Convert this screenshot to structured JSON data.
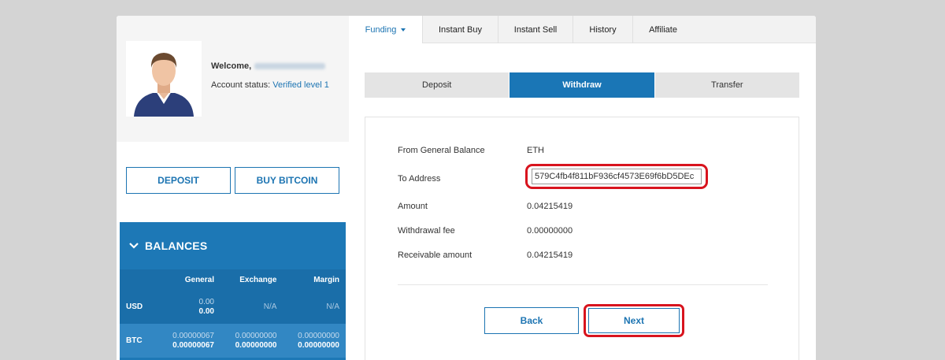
{
  "profile": {
    "welcome_label": "Welcome,",
    "account_status_label": "Account status:",
    "account_status_value": "Verified level 1"
  },
  "left_actions": {
    "deposit_label": "DEPOSIT",
    "buy_bitcoin_label": "BUY BITCOIN"
  },
  "balances": {
    "title": "BALANCES",
    "columns": [
      "",
      "General",
      "Exchange",
      "Margin"
    ],
    "rows": [
      {
        "currency": "USD",
        "general_top": "0.00",
        "general_bottom": "0.00",
        "exchange": "N/A",
        "margin": "N/A"
      },
      {
        "currency": "BTC",
        "general_top": "0.00000067",
        "general_bottom": "0.00000067",
        "exchange_top": "0.00000000",
        "exchange_bottom": "0.00000000",
        "margin_top": "0.00000000",
        "margin_bottom": "0.00000000"
      }
    ]
  },
  "topnav": {
    "tabs": [
      {
        "label": "Funding"
      },
      {
        "label": "Instant Buy"
      },
      {
        "label": "Instant Sell"
      },
      {
        "label": "History"
      },
      {
        "label": "Affiliate"
      }
    ]
  },
  "subtabs": [
    {
      "label": "Deposit"
    },
    {
      "label": "Withdraw"
    },
    {
      "label": "Transfer"
    }
  ],
  "form": {
    "from_label": "From General Balance",
    "from_value": "ETH",
    "to_label": "To Address",
    "to_value": "579C4fb4f811bF936cf4573E69f6bD5DEc",
    "amount_label": "Amount",
    "amount_value": "0.04215419",
    "fee_label": "Withdrawal fee",
    "fee_value": "0.00000000",
    "receivable_label": "Receivable amount",
    "receivable_value": "0.04215419",
    "back_label": "Back",
    "next_label": "Next"
  },
  "colors": {
    "brand_blue": "#1c74b2",
    "highlight_red": "#d8141e"
  }
}
